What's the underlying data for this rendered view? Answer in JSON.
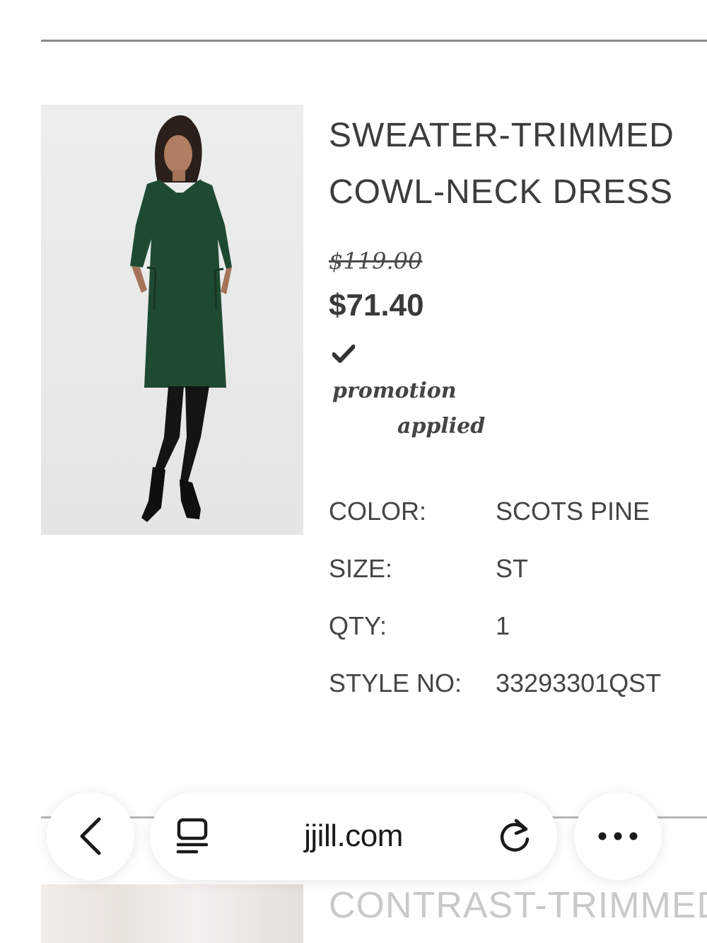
{
  "product": {
    "title_line1": "SWEATER-TRIMMED",
    "title_line2": "COWL-NECK DRESS",
    "price_original": "$119.00",
    "price_sale": "$71.40",
    "promo_line1": "promotion",
    "promo_line2": "applied",
    "image_icon": "product-photo"
  },
  "details": [
    {
      "label": "COLOR:",
      "value": "SCOTS PINE"
    },
    {
      "label": "SIZE:",
      "value": "ST"
    },
    {
      "label": "QTY:",
      "value": "1"
    },
    {
      "label": "STYLE NO:",
      "value": "33293301QST"
    }
  ],
  "browser": {
    "url": "jjill.com",
    "back_icon": "chevron-left-icon",
    "tabs_icon": "tabs-icon",
    "reload_icon": "reload-icon",
    "more_icon": "more-icon"
  },
  "next_product": {
    "title": "CONTRAST-TRIMMED"
  },
  "colors": {
    "text": "#3a3a3a",
    "dress": "#1f4a32",
    "rule": "#8a8a8a"
  }
}
